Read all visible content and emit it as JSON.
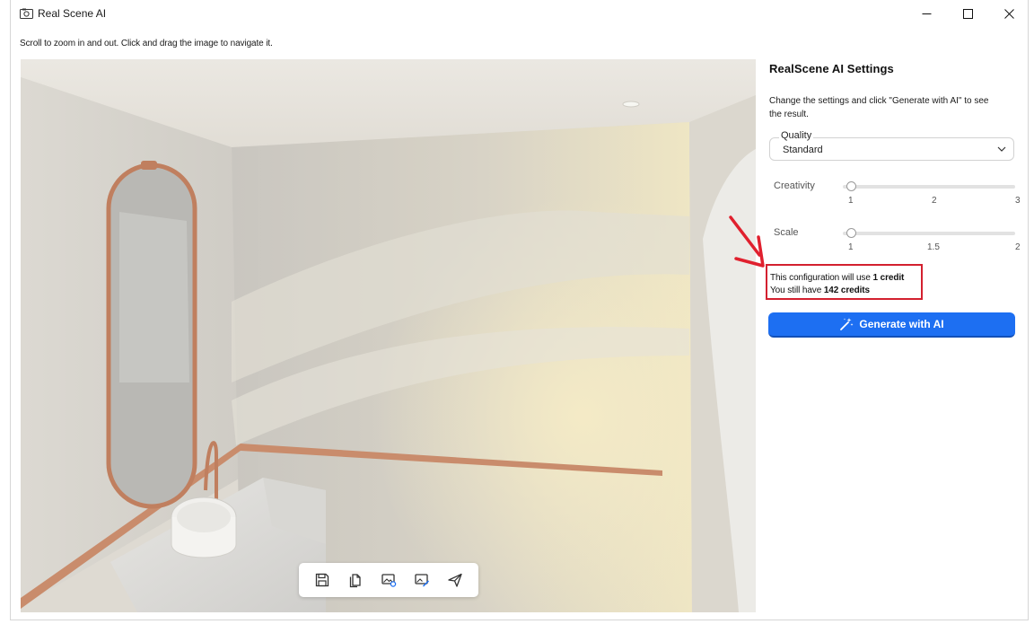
{
  "window": {
    "title": "Real Scene AI",
    "controls": {
      "minimize": "minimize",
      "maximize": "maximize",
      "close": "close"
    }
  },
  "hint": "Scroll to zoom in and out. Click and drag the image to navigate it.",
  "toolbar": {
    "buttons": [
      {
        "icon": "save-icon"
      },
      {
        "icon": "copy-icon"
      },
      {
        "icon": "image-settings-icon"
      },
      {
        "icon": "image-edit-icon"
      },
      {
        "icon": "send-icon"
      }
    ]
  },
  "settings": {
    "title": "RealScene AI Settings",
    "description": "Change the settings and click \"Generate with AI\" to see the result.",
    "quality": {
      "label": "Quality",
      "value": "Standard"
    },
    "creativity": {
      "label": "Creativity",
      "ticks": [
        "1",
        "2",
        "3"
      ],
      "value": 1,
      "min": 1,
      "max": 3
    },
    "scale": {
      "label": "Scale",
      "ticks": [
        "1",
        "1.5",
        "2"
      ],
      "value": 1,
      "min": 1,
      "max": 2
    },
    "credits": {
      "line1_prefix": "This configuration will use ",
      "line1_value": "1 credit",
      "line2_prefix": "You still have ",
      "line2_value": "142 credits"
    },
    "generate_label": "Generate with AI"
  },
  "colors": {
    "accent": "#1d6ff2",
    "highlight": "#d3202f"
  }
}
